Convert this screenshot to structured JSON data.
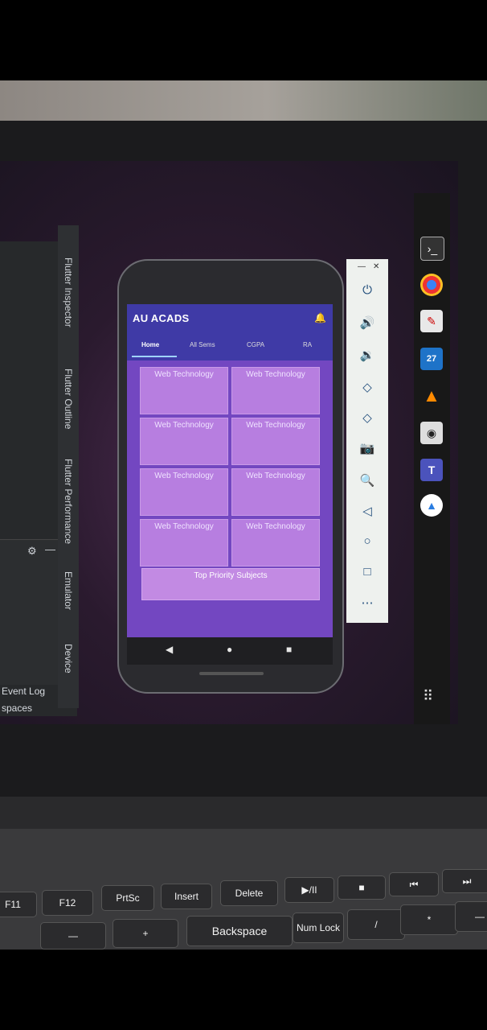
{
  "app": {
    "title": "AU ACADS",
    "tabs": [
      "Home",
      "All Sems",
      "CGPA",
      "RA"
    ],
    "cards": [
      "Web Technology",
      "Web Technology",
      "Web Technology",
      "Web Technology",
      "Web Technology",
      "Web Technology",
      "Web Technology",
      "Web Technology"
    ],
    "wide_card": "Top Priority Subjects"
  },
  "ide": {
    "side_tools": [
      "Flutter Inspector",
      "Flutter Outline",
      "Flutter Performance",
      "Emulator",
      "Device"
    ],
    "bottom": [
      "Event Log",
      "spaces"
    ]
  },
  "taskbar_badge": "27",
  "keyboard": {
    "row1": [
      "F11",
      "F12",
      "PrtSc",
      "Insert",
      "Delete",
      "▶/II",
      "■",
      "⏮",
      "⏭"
    ],
    "row2": [
      "—",
      "+",
      "Backspace",
      "Num Lock",
      "/",
      "*",
      "—"
    ]
  },
  "colors": {
    "appbar": "#3f3aa6",
    "app_bg": "#7347c1",
    "card": "#b77ee0",
    "indicator": "#9fd3ff"
  }
}
